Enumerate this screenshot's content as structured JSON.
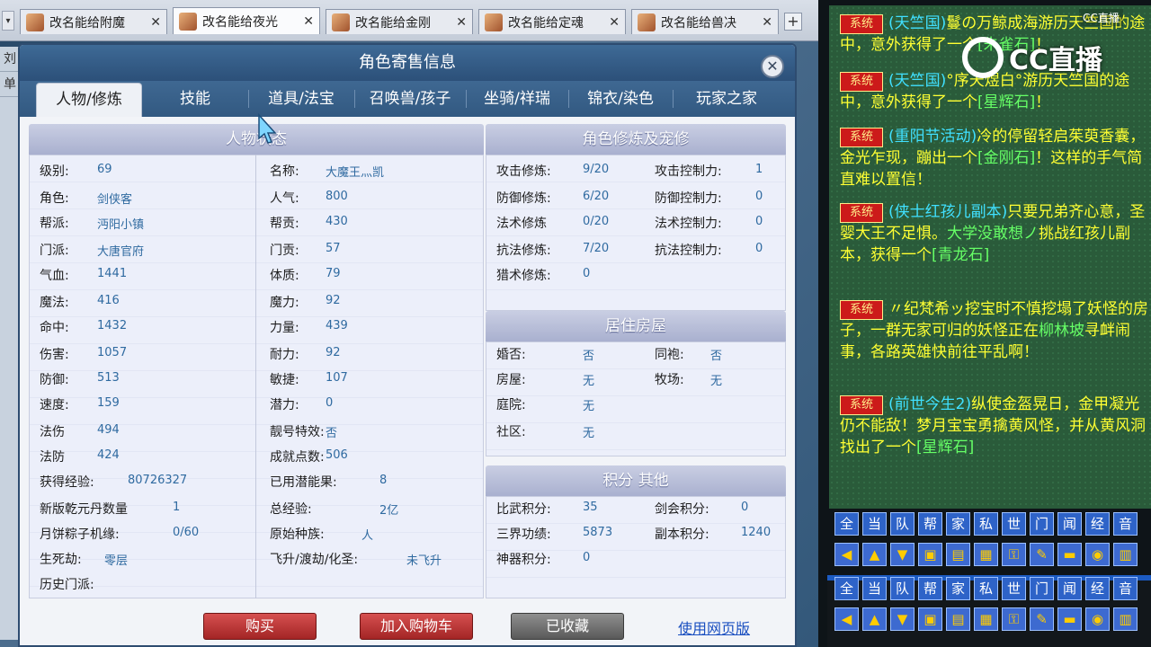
{
  "window_tabs": [
    {
      "label": "改名能给附魔",
      "active": false
    },
    {
      "label": "改名能给夜光",
      "active": true
    },
    {
      "label": "改名能给金刚",
      "active": false
    },
    {
      "label": "改名能给定魂",
      "active": false
    },
    {
      "label": "改名能给兽决",
      "active": false
    }
  ],
  "side_strip": [
    "刘",
    "单"
  ],
  "dialog": {
    "title": "角色寄售信息",
    "tabs": [
      "人物/修炼",
      "技能",
      "道具/法宝",
      "召唤兽/孩子",
      "坐骑/祥瑞",
      "锦衣/染色",
      "玩家之家"
    ],
    "active_tab": 0
  },
  "status": {
    "heading": "人物状态",
    "left": [
      {
        "label": "级别:",
        "value": "69"
      },
      {
        "label": "角色:",
        "value": "剑侠客"
      },
      {
        "label": "帮派:",
        "value": "沔阳小镇"
      },
      {
        "label": "门派:",
        "value": "大唐官府"
      },
      {
        "label": "气血:",
        "value": "1441"
      },
      {
        "label": "魔法:",
        "value": "416"
      },
      {
        "label": "命中:",
        "value": "1432"
      },
      {
        "label": "伤害:",
        "value": "1057"
      },
      {
        "label": "防御:",
        "value": "513"
      },
      {
        "label": "速度:",
        "value": "159"
      },
      {
        "label": "法伤",
        "value": "494"
      },
      {
        "label": "法防",
        "value": "424"
      },
      {
        "label": "获得经验:",
        "value": "80726327"
      },
      {
        "label": "新版乾元丹数量",
        "value": "1"
      },
      {
        "label": "月饼粽子机缘:",
        "value": "0/60"
      },
      {
        "label": "生死劫:",
        "value": "零层"
      },
      {
        "label": "历史门派:",
        "value": ""
      }
    ],
    "right": [
      {
        "label": "名称:",
        "value": "大魔王灬凯"
      },
      {
        "label": "人气:",
        "value": "800"
      },
      {
        "label": "帮贡:",
        "value": "430"
      },
      {
        "label": "门贡:",
        "value": "57"
      },
      {
        "label": "体质:",
        "value": "79"
      },
      {
        "label": "魔力:",
        "value": "92"
      },
      {
        "label": "力量:",
        "value": "439"
      },
      {
        "label": "耐力:",
        "value": "92"
      },
      {
        "label": "敏捷:",
        "value": "107"
      },
      {
        "label": "潜力:",
        "value": "0"
      },
      {
        "label": "靓号特效:",
        "value": "否"
      },
      {
        "label": "成就点数:",
        "value": "506"
      },
      {
        "label": "已用潜能果:",
        "value": "8"
      },
      {
        "label": "总经验:",
        "value": "2亿"
      },
      {
        "label": "原始种族:",
        "value": "人"
      },
      {
        "label": "飞升/渡劫/化圣:",
        "value": "未飞升"
      }
    ]
  },
  "cultivation": {
    "heading": "角色修炼及宠修",
    "rows": [
      {
        "l1": "攻击修炼:",
        "v1": "9/20",
        "l2": "攻击控制力:",
        "v2": "1"
      },
      {
        "l1": "防御修炼:",
        "v1": "6/20",
        "l2": "防御控制力:",
        "v2": "0"
      },
      {
        "l1": "法术修炼",
        "v1": "0/20",
        "l2": "法术控制力:",
        "v2": "0"
      },
      {
        "l1": "抗法修炼:",
        "v1": "7/20",
        "l2": "抗法控制力:",
        "v2": "0"
      },
      {
        "l1": "猎术修炼:",
        "v1": "0",
        "l2": "",
        "v2": ""
      }
    ]
  },
  "housing": {
    "heading": "居住房屋",
    "rows": [
      {
        "l1": "婚否:",
        "v1": "否",
        "l2": "同袍:",
        "v2": "否"
      },
      {
        "l1": "房屋:",
        "v1": "无",
        "l2": "牧场:",
        "v2": "无"
      },
      {
        "l1": "庭院:",
        "v1": "无",
        "l2": "",
        "v2": ""
      },
      {
        "l1": "社区:",
        "v1": "无",
        "l2": "",
        "v2": ""
      }
    ]
  },
  "points": {
    "heading": "积分 其他",
    "rows": [
      {
        "l1": "比武积分:",
        "v1": "35",
        "l2": "剑会积分:",
        "v2": "0"
      },
      {
        "l1": "三界功绩:",
        "v1": "5873",
        "l2": "副本积分:",
        "v2": "1240"
      },
      {
        "l1": "神器积分:",
        "v1": "0",
        "l2": "",
        "v2": ""
      }
    ]
  },
  "buttons": {
    "buy": "购买",
    "add_cart": "加入购物车",
    "favorited": "已收藏",
    "web": "使用网页版"
  },
  "chat": {
    "logo": "CC直播",
    "logo_small": "CC直播",
    "badge": "系统",
    "messages": [
      {
        "parts": [
          {
            "t": "(天竺国)",
            "c": "cyan"
          },
          {
            "t": "鬘の万鲸成海游历天竺国的途中，意外获得了一个",
            "c": "yellow"
          },
          {
            "t": "[朱雀石]",
            "c": "green"
          },
          {
            "t": "！",
            "c": "yellow"
          }
        ]
      },
      {
        "parts": [
          {
            "t": "(天竺国)",
            "c": "cyan"
          },
          {
            "t": "°序天煜白°游历天竺国的途中，意外获得了一个",
            "c": "yellow"
          },
          {
            "t": "[星辉石]",
            "c": "green"
          },
          {
            "t": "！",
            "c": "yellow"
          }
        ]
      },
      {
        "parts": [
          {
            "t": "(重阳节活动)",
            "c": "cyan"
          },
          {
            "t": "冷的停留轻启茱萸香囊，金光乍现，蹦出一个",
            "c": "yellow"
          },
          {
            "t": "[金刚石]",
            "c": "green"
          },
          {
            "t": "！这样的手气简直难以置信！",
            "c": "yellow"
          }
        ]
      },
      {
        "parts": [
          {
            "t": "(侠士红孩儿副本)",
            "c": "cyan"
          },
          {
            "t": "只要兄弟齐心意，圣婴大王不足惧。",
            "c": "yellow"
          },
          {
            "t": "大学没敢想ノ",
            "c": "green"
          },
          {
            "t": "挑战红孩儿副本，获得一个",
            "c": "yellow"
          },
          {
            "t": "[青龙石]",
            "c": "green"
          }
        ]
      },
      {
        "parts": [
          {
            "t": "〃纪梵希ッ挖宝时不慎挖塌了妖怪的房子，一群无家可归的妖怪正在",
            "c": "yellow"
          },
          {
            "t": "柳林坡",
            "c": "green"
          },
          {
            "t": "寻衅闹事，各路英雄快前往平乱啊！",
            "c": "yellow"
          }
        ]
      },
      {
        "parts": [
          {
            "t": "(前世今生2)",
            "c": "cyan"
          },
          {
            "t": "纵使金盔晃日，金甲凝光仍不能敌！梦月宝宝勇擒黄风怪，并从黄风洞找出了一个",
            "c": "yellow"
          },
          {
            "t": "[星辉石]",
            "c": "green"
          }
        ]
      }
    ],
    "channels": [
      "全",
      "当",
      "队",
      "帮",
      "家",
      "私",
      "世",
      "门",
      "闻",
      "经",
      "音"
    ],
    "icons": [
      "◀",
      "▲",
      "▼",
      "▣",
      "▤",
      "▦",
      "⚿",
      "✎",
      "▬",
      "◉",
      "▥"
    ]
  }
}
